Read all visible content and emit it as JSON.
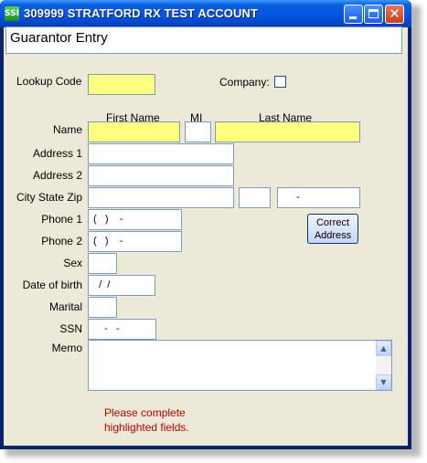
{
  "window": {
    "title": "309999 STRATFORD RX TEST ACCOUNT",
    "app_icon_text": "SSI",
    "close_glyph": "✕"
  },
  "form": {
    "title": "Guarantor Entry",
    "lookup_code": {
      "label": "Lookup Code",
      "value": ""
    },
    "company": {
      "label": "Company:",
      "checked": false
    },
    "name": {
      "label": "Name",
      "first_name_header": "First Name",
      "mi_header": "MI",
      "last_name_header": "Last Name",
      "first": "",
      "mi": "",
      "last": ""
    },
    "address1": {
      "label": "Address 1",
      "value": ""
    },
    "address2": {
      "label": "Address 2",
      "value": ""
    },
    "city_state_zip": {
      "label": "City State Zip",
      "city": "",
      "state": "",
      "zip": "     -"
    },
    "phone1": {
      "label": "Phone 1",
      "value": "(   )    -"
    },
    "phone2": {
      "label": "Phone 2",
      "value": "(   )    -"
    },
    "correct_address_button": {
      "line1": "Correct",
      "line2": "Address"
    },
    "sex": {
      "label": "Sex",
      "value": ""
    },
    "date_of_birth": {
      "label": "Date of birth",
      "value": "  /  /"
    },
    "marital": {
      "label": "Marital",
      "value": ""
    },
    "ssn": {
      "label": "SSN",
      "value": "    -   -"
    },
    "memo": {
      "label": "Memo",
      "value": ""
    },
    "warning_line1": "Please complete",
    "warning_line2": "highlighted fields."
  },
  "colors": {
    "required_field": "#ffff80",
    "warning_text": "#c00000",
    "client_background": "#ece9d8"
  }
}
